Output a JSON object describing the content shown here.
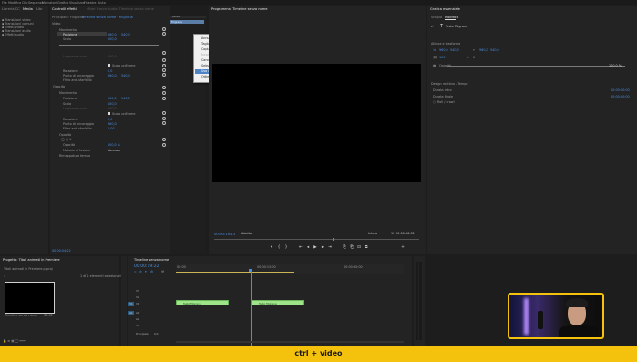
{
  "menubar": [
    "File",
    "Modifica",
    "Clip",
    "Sequenza",
    "Marcatori",
    "Grafica",
    "Visualizza",
    "Finestra",
    "Aiuto"
  ],
  "project_panel": {
    "tabs": [
      "Libreria CC",
      "Media",
      "Libr"
    ],
    "folders": [
      "Transizioni video",
      "Transizioni comuni",
      "Effetti video",
      "Transizioni audio",
      "Effetti audio"
    ]
  },
  "effects_panel": {
    "tabs": [
      "Controlli effetti",
      "Mixer tracce audio: Timeline senza nome"
    ],
    "subtabs": [
      "Principale: Filigrana",
      "Timeline senza nome · Filigrana"
    ],
    "mini_time_label": "00:00",
    "mini_clip_label": "Filigrana",
    "section_video": "Video",
    "motion_label": "Movimento",
    "position_label": "Posizione",
    "position_x": "960,0",
    "position_y": "540,0",
    "scale_label": "Scala",
    "scale_value": "100,0",
    "scale_width_label": "Larghezza scala",
    "scale_width_value": "100,0",
    "uniform_scale": "Scala uniforme",
    "rotation_label": "Rotazione",
    "rotation_value": "0,0",
    "anchor_label": "Punto di ancoraggio",
    "anchor_x": "960,0",
    "anchor_y": "540,0",
    "antiflicker_label": "Filtro anti-sfarfallio",
    "antiflicker_value": "0,00",
    "opacity_section": "Opacità",
    "opacity_label": "Opacità",
    "opacity_value": "100,0 %",
    "blend_label": "Metodo di fusione",
    "blend_value": "Normale",
    "time_remap": "Rimappatura tempo",
    "audio_label": "Audio",
    "volume_label": "Volume",
    "speed_label": "Velocità",
    "speed_value": "100,00 %",
    "mode_label": "Modalità di fusione",
    "bottom_time": "00:00:04:22"
  },
  "context_menu": {
    "items": [
      "Annulla",
      "Taglia",
      "Copia",
      "Incolla",
      "Cancella",
      "Seleziona tutto",
      "Usa   Rilevamento livello",
      "Ottimizzazione parole"
    ],
    "disabled_index": 3,
    "highlighted_index": 6
  },
  "program_monitor": {
    "tab": "Programma: Timeline senza nome",
    "timecode": "00:00:19:13",
    "fit": "Adatta",
    "quality": "Intera",
    "duration": "00:00:36:02"
  },
  "essential_graphics": {
    "tabs": [
      "Grafica essenziale",
      "Sfoglia",
      "Modifica"
    ],
    "layer_name": "Testo Filigrana",
    "section_align": "Allinea e trasforma",
    "pos_x": "960,0",
    "pos_y": "540,0",
    "scale_pct": "100",
    "rotation_val": "0",
    "opacity_label": "Opacità",
    "opacity_val": "100,0 %",
    "master_styles": "Stili testo master",
    "none_label": "Nessuno",
    "master_style": "Stile master testo",
    "text_label": "Testo",
    "font_label": "Font",
    "responsive_label": "Design reattivo - Tempo",
    "intro_label": "Durata intro",
    "outro_label": "Durata finale",
    "roll_label": "Roll / crawl",
    "intro_value": "00:00:00:00",
    "outro_value": "00:00:00:00",
    "accent_color": "#4b8ee0"
  },
  "media_panel": {
    "tab": "Progetto: Titoli animati in Premiere",
    "path": "Titoli animati in Premiere.prproj",
    "items_count": "1 di 2 elementi selezionati",
    "thumb_label": "Timeline senza nome",
    "thumb_duration": "36:02"
  },
  "timeline": {
    "tab": "Timeline senza nome",
    "timecode": "00:00:19:22",
    "ruler_labels": [
      "00:00",
      "00:00:15:00",
      "00:00:30:00"
    ],
    "video_tracks": [
      "V3",
      "V2",
      "V1"
    ],
    "audio_tracks": [
      "A1",
      "A2",
      "A3"
    ],
    "master_label": "Principale",
    "master_value": "0,0",
    "clip_label": "Testo filigrana",
    "track_label_v1": "V1",
    "track_label_a1": "A1"
  },
  "caption_bar": {
    "text": "ctrl + video",
    "color": "#f4c20d"
  },
  "webcam_frame_color": "#f4c20d"
}
